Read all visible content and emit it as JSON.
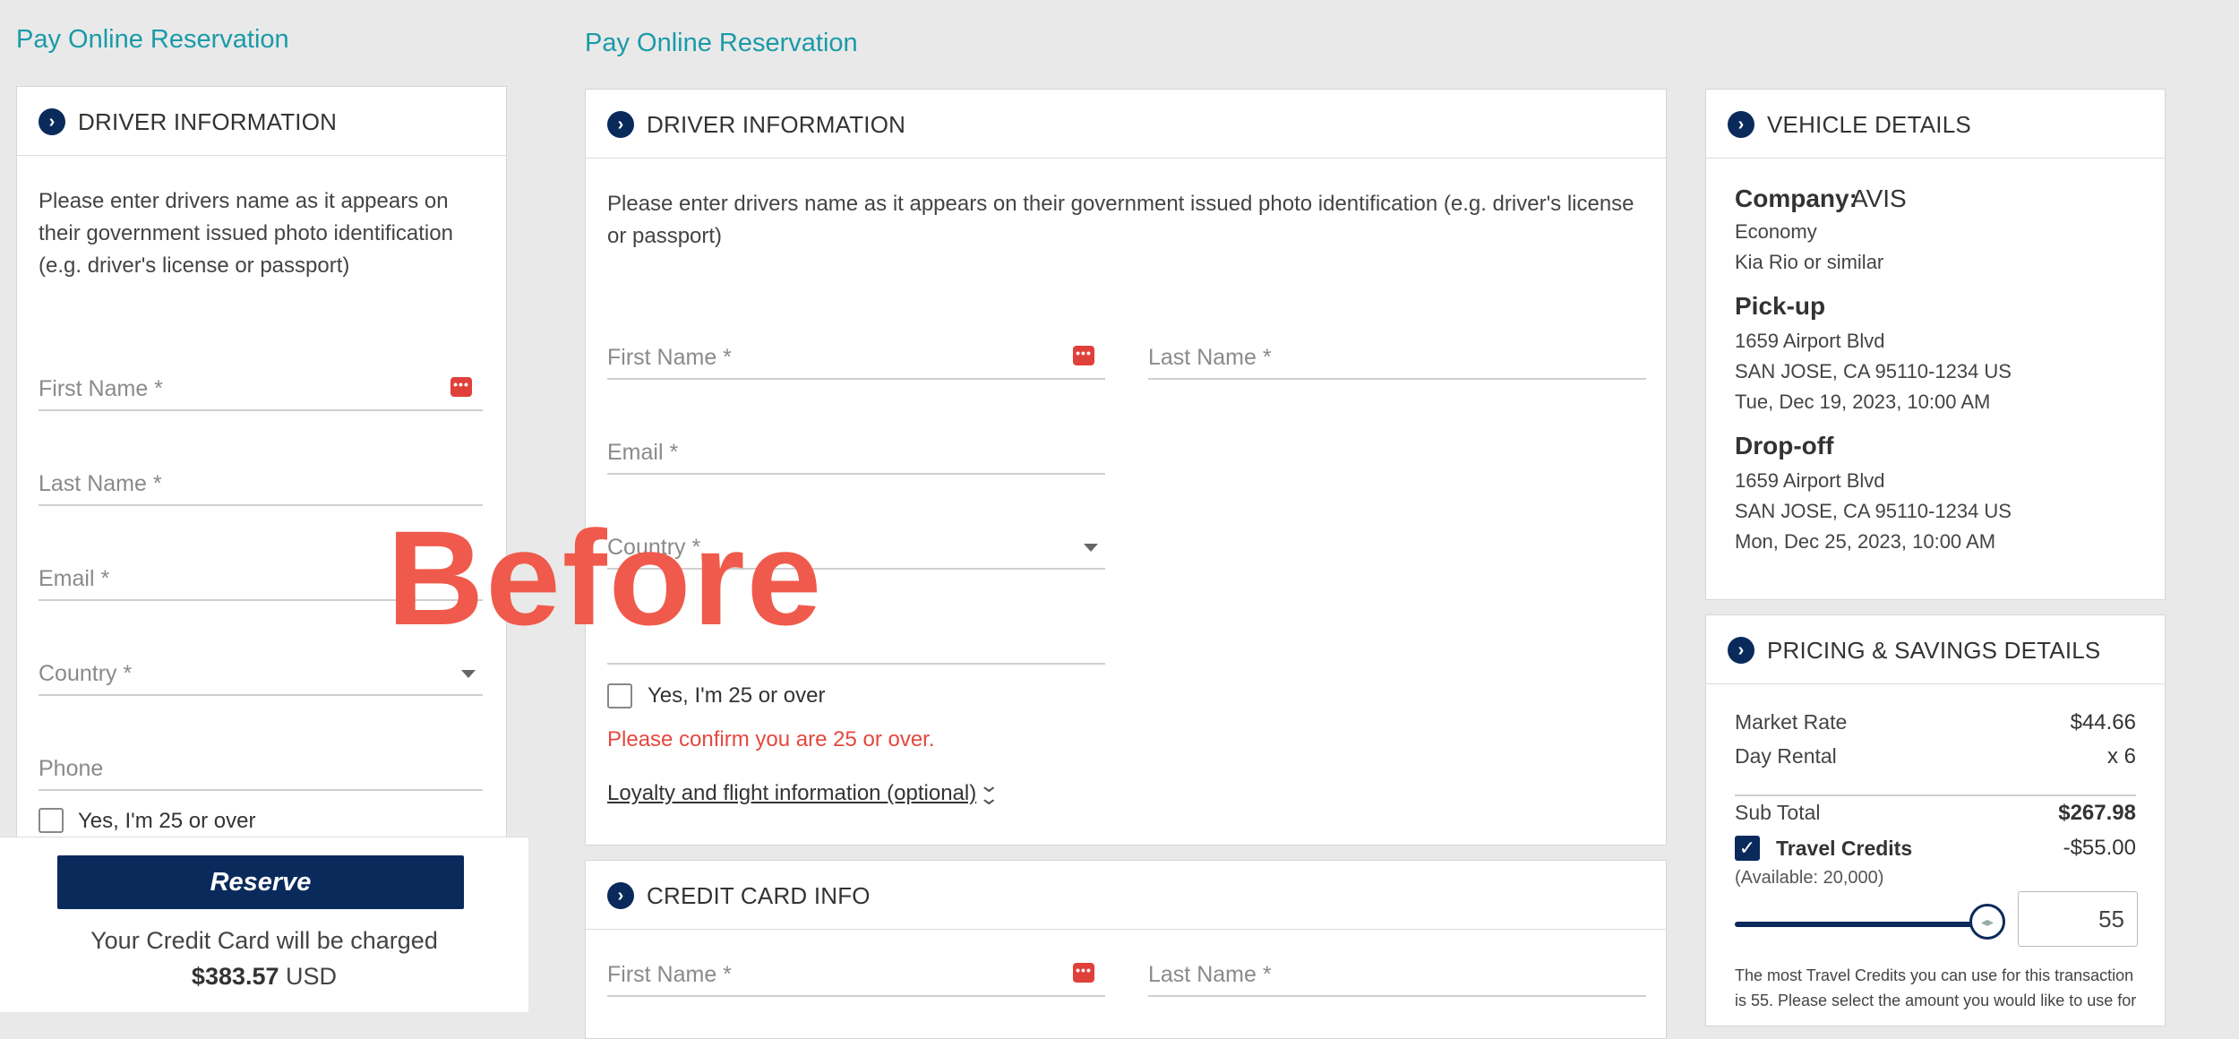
{
  "page": {
    "title_left": "Pay Online Reservation",
    "title_right": "Pay Online Reservation",
    "overlay_text": "Before"
  },
  "icons": {
    "section": "chevron-right-circle-icon",
    "password_manager": "password-dots-icon",
    "dropdown": "caret-down-icon",
    "expand": "double-chevron-down-icon"
  },
  "colors": {
    "accent_teal": "#1a9aa8",
    "brand_navy": "#0a2a5c",
    "error": "#e5483e",
    "overlay": "#f05a4c"
  },
  "left_panel": {
    "header": "DRIVER INFORMATION",
    "note": "Please enter drivers name as it appears on their government issued photo identification (e.g. driver's license or passport)",
    "fields": {
      "first_name": "First Name *",
      "last_name": "Last Name *",
      "email": "Email *",
      "country": "Country *",
      "phone": "Phone"
    },
    "age_checkbox": "Yes, I'm 25 or over"
  },
  "main": {
    "driver": {
      "header": "DRIVER INFORMATION",
      "note": "Please enter drivers name as it appears on their government issued photo identification (e.g. driver's license or passport)",
      "first_name": "First Name *",
      "last_name": "Last Name *",
      "email": "Email *",
      "country": "Country *",
      "age_checkbox": "Yes, I'm 25 or over",
      "age_error": "Please confirm you are 25 or over.",
      "loyalty_link": "Loyalty and flight information (optional)"
    },
    "credit_card": {
      "header": "CREDIT CARD INFO",
      "first_name": "First Name *",
      "last_name": "Last Name *"
    }
  },
  "vehicle": {
    "header": "VEHICLE DETAILS",
    "company_label": "Company:",
    "company": "AVIS",
    "class": "Economy",
    "model": "Kia Rio or similar",
    "pickup_label": "Pick-up",
    "pickup_address": "1659 Airport Blvd",
    "pickup_city": "SAN JOSE, CA 95110-1234 US",
    "pickup_time": "Tue, Dec 19, 2023, 10:00 AM",
    "dropoff_label": "Drop-off",
    "dropoff_address": "1659 Airport Blvd",
    "dropoff_city": "SAN JOSE, CA 95110-1234 US",
    "dropoff_time": "Mon, Dec 25, 2023, 10:00 AM"
  },
  "pricing": {
    "header": "PRICING & SAVINGS DETAILS",
    "market_rate_label": "Market Rate",
    "market_rate": "$44.66",
    "day_rental_label": "Day Rental",
    "day_rental": "x 6",
    "subtotal_label": "Sub Total",
    "subtotal": "$267.98",
    "travel_credits_label": "Travel Credits",
    "travel_credits": "-$55.00",
    "available": "(Available: 20,000)",
    "credits_input": "55",
    "slider_fraction": 0.94,
    "note_line1": "The most Travel Credits you can use for this transaction",
    "note_line2": "is 55. Please select the amount you would like to use for"
  },
  "footer": {
    "reserve_label": "Reserve",
    "charge_text": "Your Credit Card will be charged",
    "amount": "$383.57",
    "currency": "USD"
  }
}
